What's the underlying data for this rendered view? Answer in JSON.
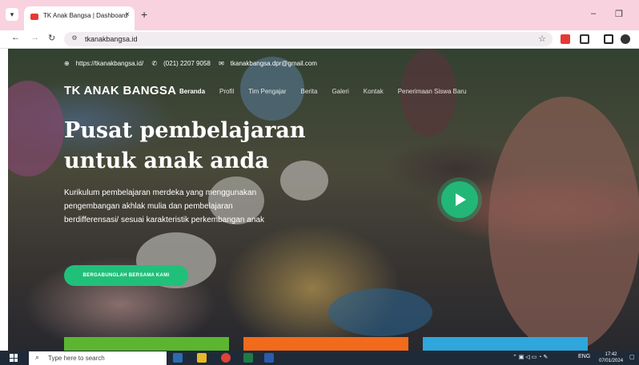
{
  "browser": {
    "tab_title": "TK Anak Bangsa | Dashboard",
    "tab_close": "×",
    "new_tab": "+",
    "url": "tkanakbangsa.id",
    "minimize": "–",
    "restore": "❐"
  },
  "site": {
    "contact": {
      "website": "https://tkanakbangsa.id/",
      "phone": "(021) 2207 9058",
      "email": "tkanakbangsa.dpr@gmail.com"
    },
    "brand": "TK ANAK BANGSA",
    "menu": [
      "Beranda",
      "Profil",
      "Tim Pengajar",
      "Berita",
      "Galeri",
      "Kontak",
      "Penerimaan Siswa Baru"
    ],
    "active_menu_index": 0,
    "headline": "Pusat pembelajaran untuk anak anda",
    "lead": "Kurikulum pembelajaran merdeka yang menggunakan pengembangan akhlak mulia dan pembelajaran berdifferensasi/ sesuai karakteristik perkembangan anak",
    "cta_label": "BERGABUNGLAH BERSAMA KAMI"
  },
  "taskbar": {
    "search_placeholder": "Type here to search",
    "language": "ENG",
    "time": "17:42",
    "date": "07/01/2024"
  },
  "colors": {
    "accent": "#21c07a",
    "tabstrip": "#f9d2e0",
    "strip_green": "#5cb531",
    "strip_orange": "#f26a1b",
    "strip_blue": "#2fa6dc"
  }
}
